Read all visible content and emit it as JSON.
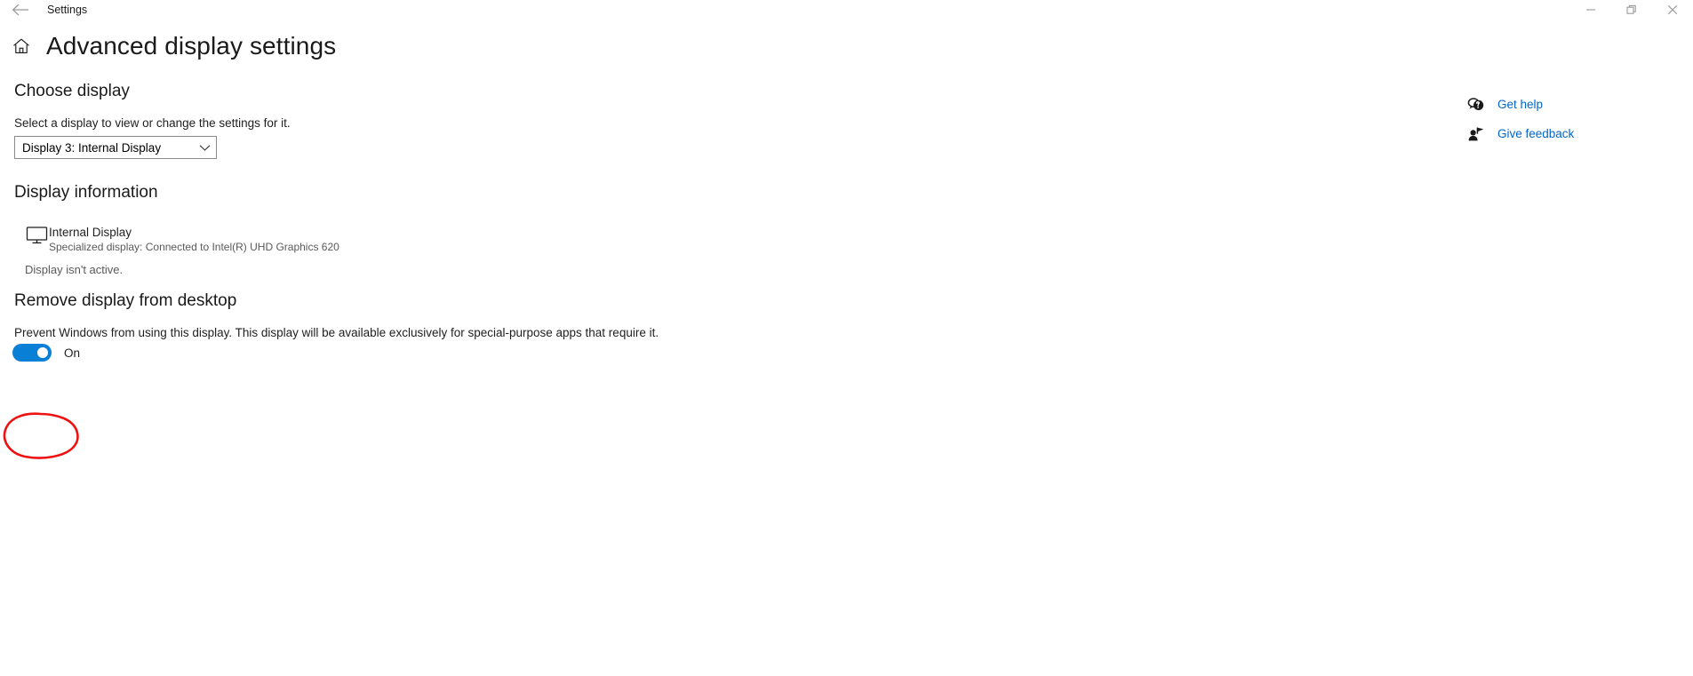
{
  "window": {
    "titlebar_title": "Settings",
    "back_icon": "back-arrow-icon",
    "minimize_label": "—",
    "restore_label": "restore-icon",
    "close_label": "×"
  },
  "header": {
    "home_icon": "home-icon",
    "page_title": "Advanced display settings"
  },
  "choose_display": {
    "heading": "Choose display",
    "description": "Select a display to view or change the settings for it.",
    "dropdown_value": "Display 3: Internal Display",
    "dropdown_icon": "chevron-down-icon"
  },
  "display_information": {
    "heading": "Display information",
    "monitor_icon": "monitor-icon",
    "display_name": "Internal Display",
    "display_detail": "Specialized display: Connected to Intel(R) UHD Graphics 620",
    "status": "Display isn't active."
  },
  "remove_display": {
    "heading": "Remove display from desktop",
    "description": "Prevent Windows from using this display. This display will be available exclusively for special-purpose apps that require it.",
    "toggle_state": "On",
    "toggle_on": true,
    "toggle_color": "#0a7fd6"
  },
  "side_links": {
    "get_help": {
      "label": "Get help",
      "icon": "help-speech-bubble-icon"
    },
    "give_feedback": {
      "label": "Give feedback",
      "icon": "feedback-person-icon"
    },
    "link_color": "#0066cc"
  },
  "annotation": {
    "type": "hand-drawn-ellipse",
    "color": "#ee1111",
    "target": "remove-display-toggle"
  }
}
